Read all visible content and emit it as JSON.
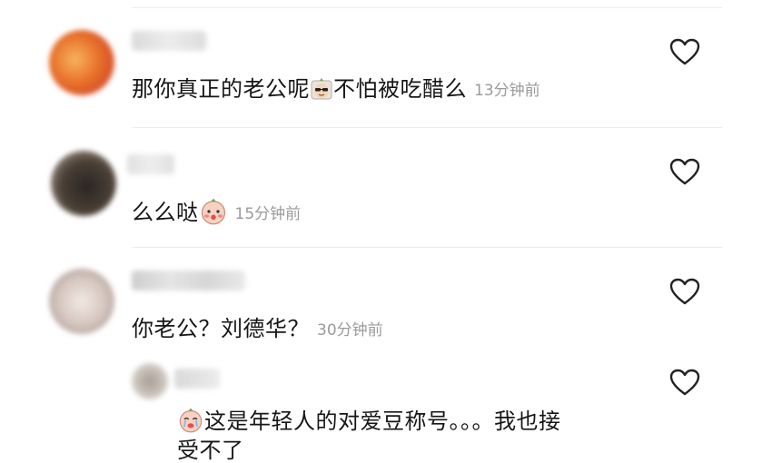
{
  "comments": [
    {
      "text_before": "那你真正的老公呢",
      "text_after": "不怕被吃醋么",
      "emoji": "sunglasses-face-emoji",
      "time": "13分钟前",
      "like_icon": "heart-outline-icon"
    },
    {
      "text_before": "么么哒",
      "emoji": "blushing-face-emoji",
      "time": "15分钟前",
      "like_icon": "heart-outline-icon"
    },
    {
      "text_before": "你老公？刘德华？",
      "time": "30分钟前",
      "like_icon": "heart-outline-icon"
    }
  ],
  "reply": {
    "emoji": "crying-face-emoji",
    "line1": "这是年轻人的对爱豆称号。。。我也接",
    "line2": "受不了",
    "like_icon": "heart-outline-icon"
  },
  "colors": {
    "time_gray": "#9a9a9a",
    "text": "#161616",
    "heart_stroke": "#222222"
  }
}
